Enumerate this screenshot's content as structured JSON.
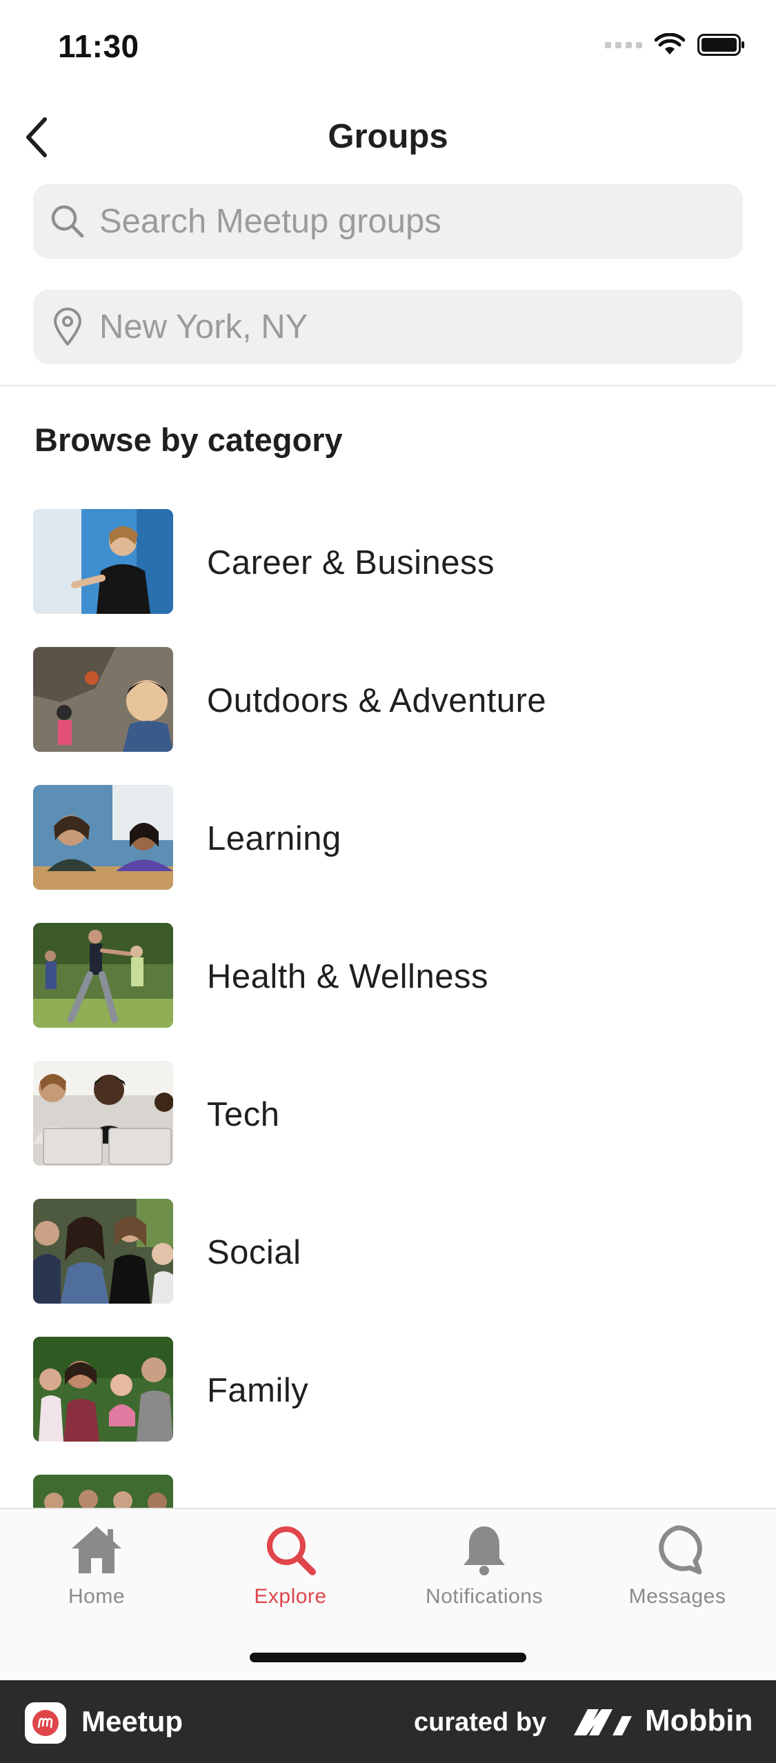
{
  "status_bar": {
    "time": "11:30"
  },
  "header": {
    "title": "Groups"
  },
  "search": {
    "placeholder": "Search Meetup groups"
  },
  "location": {
    "placeholder": "New York, NY"
  },
  "browse": {
    "title": "Browse by category",
    "categories": [
      {
        "label": "Career & Business"
      },
      {
        "label": "Outdoors & Adventure"
      },
      {
        "label": "Learning"
      },
      {
        "label": "Health & Wellness"
      },
      {
        "label": "Tech"
      },
      {
        "label": "Social"
      },
      {
        "label": "Family"
      },
      {
        "label": ""
      }
    ]
  },
  "tabs": [
    {
      "label": "Home",
      "icon": "home-icon",
      "active": false
    },
    {
      "label": "Explore",
      "icon": "search-icon",
      "active": true
    },
    {
      "label": "Notifications",
      "icon": "bell-icon",
      "active": false
    },
    {
      "label": "Messages",
      "icon": "chat-bubble-icon",
      "active": false
    }
  ],
  "brand_bar": {
    "app_name": "Meetup",
    "curated_by": "curated by",
    "curator": "Mobbin"
  },
  "colors": {
    "accent": "#e0454a",
    "inactive": "#8a8a8a",
    "field_bg": "#f0f0f0",
    "brand_bar": "#2b2b2b"
  }
}
